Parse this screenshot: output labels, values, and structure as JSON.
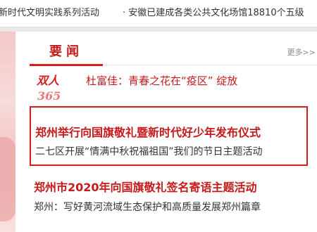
{
  "ticker": {
    "items": [
      "新时代文明实践系列活动",
      "· 安徽已建成各类公共文化场馆18810个五级"
    ]
  },
  "section": {
    "title": "要闻",
    "more_label": "更多>>"
  },
  "logo": {
    "text": "双人",
    "number": "365"
  },
  "headlines": {
    "logo_headline": "杜富佳：青春之花在“疫区” 绽放",
    "featured_title": "郑州举行向国旗敬礼暨新时代好少年发布仪式",
    "featured_sub": "二七区开展“情满中秋祝福祖国”我们的节日主题活动",
    "second_title": "郑州市2020年向国旗敬礼签名寄语主题活动",
    "second_sub": "郑州：写好黄河流域生态保护和高质量发展郑州篇章"
  },
  "colors": {
    "accent": "#d51f1f",
    "headline_red": "#c61a1a",
    "body_text": "#333333"
  }
}
